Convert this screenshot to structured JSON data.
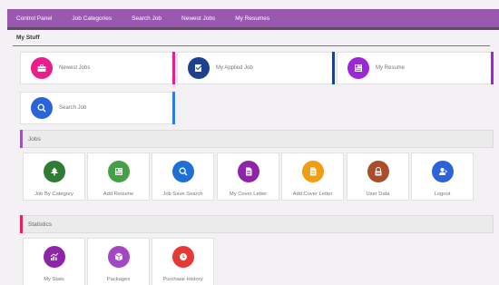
{
  "nav": {
    "items": [
      {
        "label": "Control Panel"
      },
      {
        "label": "Job Categories"
      },
      {
        "label": "Search Job"
      },
      {
        "label": "Newest Jobs"
      },
      {
        "label": "My Resumes"
      }
    ]
  },
  "my_stuff": {
    "title": "My Stuff",
    "cards": [
      {
        "label": "Newest Jobs",
        "icon": "briefcase-icon",
        "circle_color": "#e91e8c",
        "edge_color": "#e91e8c"
      },
      {
        "label": "My Applied Job",
        "icon": "applied-job-icon",
        "circle_color": "#1f3f8f",
        "edge_color": "#1f3f8f"
      },
      {
        "label": "My Resume",
        "icon": "resume-icon",
        "circle_color": "#9c27d6",
        "edge_color": "#9c27d6"
      },
      {
        "label": "Search Job",
        "icon": "search-icon",
        "circle_color": "#2b63d9",
        "edge_color": "#2b7de9"
      }
    ]
  },
  "jobs": {
    "title": "Jobs",
    "accent": "#9b58b1",
    "tiles": [
      {
        "label": "Job By Category",
        "icon": "tree-icon",
        "color": "#2e7d32"
      },
      {
        "label": "Add Resume",
        "icon": "add-resume-icon",
        "color": "#43a047"
      },
      {
        "label": "Job Save Search",
        "icon": "search-icon",
        "color": "#1e6fd6"
      },
      {
        "label": "My Cover Letter",
        "icon": "document-icon",
        "color": "#8e24aa"
      },
      {
        "label": "Add Cover Letter",
        "icon": "document-icon",
        "color": "#f39c12"
      },
      {
        "label": "User Data",
        "icon": "user-data-icon",
        "color": "#a84e2b"
      },
      {
        "label": "Logout",
        "icon": "logout-icon",
        "color": "#2b63d9"
      }
    ]
  },
  "statistics": {
    "title": "Statistics",
    "accent": "#e91e63",
    "tiles": [
      {
        "label": "My Stats",
        "icon": "stats-chart-icon",
        "color": "#8e24aa"
      },
      {
        "label": "Packages",
        "icon": "package-icon",
        "color": "#a347c4"
      },
      {
        "label": "Purchase History",
        "icon": "history-clock-icon",
        "color": "#e53935"
      }
    ]
  }
}
